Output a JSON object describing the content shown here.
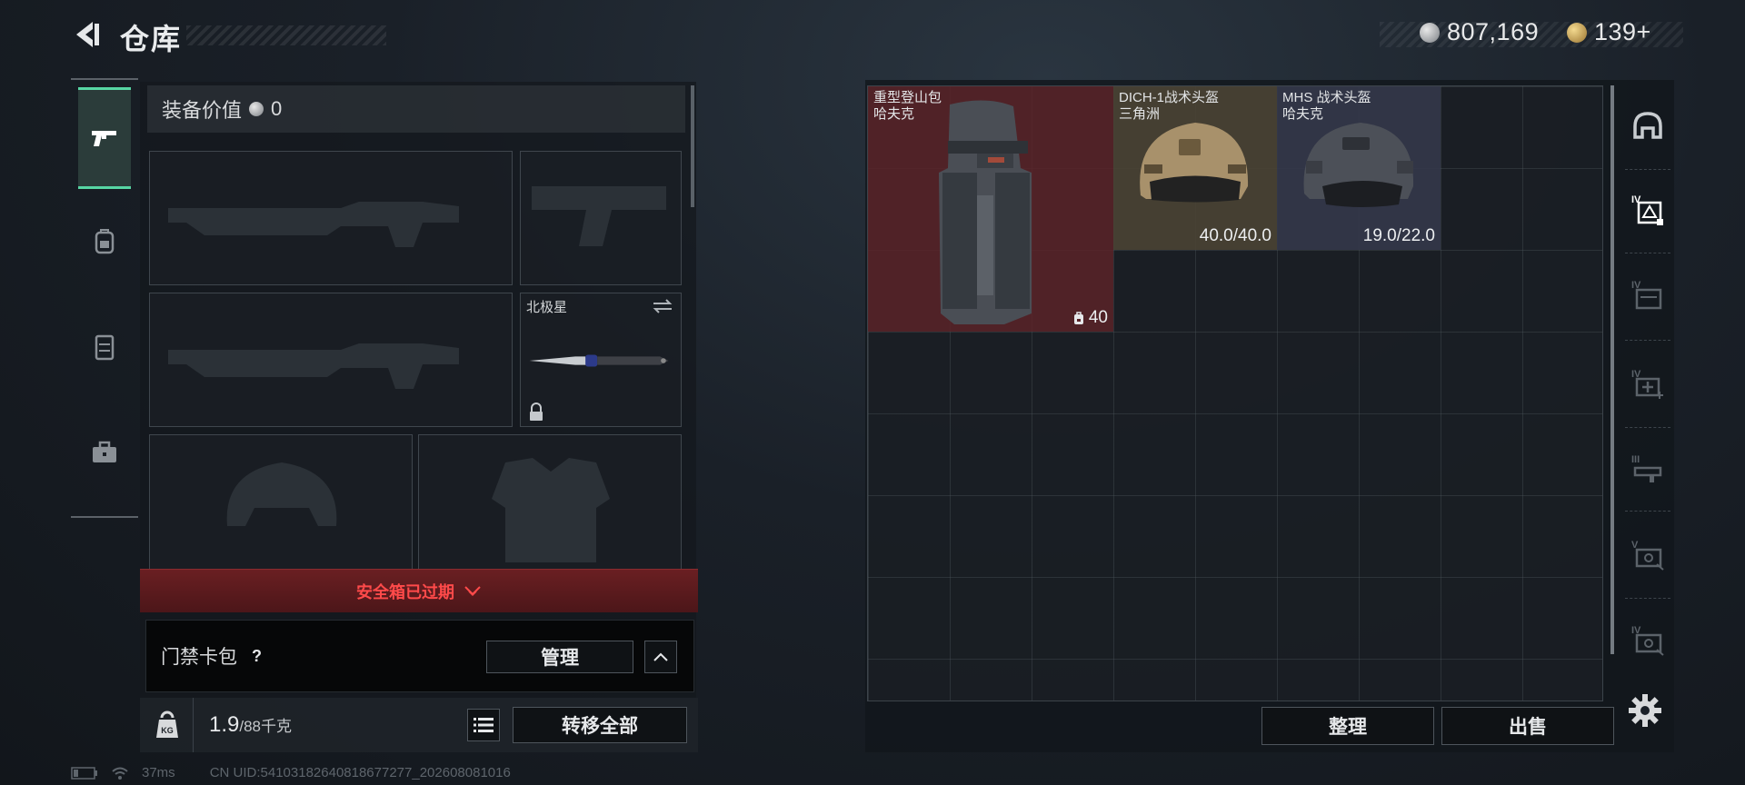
{
  "header": {
    "title": "仓库",
    "currency_silver": "807,169",
    "currency_gold": "139+"
  },
  "left_tabs": [
    {
      "name": "weapons",
      "icon": "pistol-icon",
      "active": true
    },
    {
      "name": "backpack",
      "icon": "backpack-icon",
      "active": false
    },
    {
      "name": "rig",
      "icon": "vest-icon",
      "active": false
    },
    {
      "name": "toolbox",
      "icon": "briefcase-icon",
      "active": false
    }
  ],
  "equipment": {
    "value_label": "装备价值",
    "value": "0",
    "melee_slot_label": "北极星",
    "safebox_status": "安全箱已过期",
    "keycard_label": "门禁卡包",
    "keycard_help": "?",
    "manage_label": "管理",
    "weight_current": "1.9",
    "weight_max": "/88千克",
    "weight_icon_text": "KG",
    "transfer_all_label": "转移全部"
  },
  "stash_items": [
    {
      "name": "重型登山包",
      "brand": "哈夫克",
      "value": "40",
      "bg": "#5a2328"
    },
    {
      "name": "DICH-1战术头盔",
      "brand": "三角洲",
      "value": "40.0/40.0",
      "bg": "#4a4234"
    },
    {
      "name": "MHS 战术头盔",
      "brand": "哈夫克",
      "value": "19.0/22.0",
      "bg": "#34374a"
    }
  ],
  "stash_actions": {
    "sort_label": "整理",
    "sell_label": "出售"
  },
  "right_icons": [
    {
      "icon": "helmet-icon",
      "badge": ""
    },
    {
      "icon": "armor-tier-icon",
      "badge": "IV"
    },
    {
      "icon": "case-tier-icon",
      "badge": "IV"
    },
    {
      "icon": "medkit-tier-icon",
      "badge": "IV"
    },
    {
      "icon": "ammo-tier-icon",
      "badge": "III"
    },
    {
      "icon": "part-tier-icon",
      "badge": "V"
    },
    {
      "icon": "attachment-tier-icon",
      "badge": "IV"
    }
  ],
  "status": {
    "ping": "37ms",
    "uid": "CN UID:54103182640818677277_202608081016"
  }
}
